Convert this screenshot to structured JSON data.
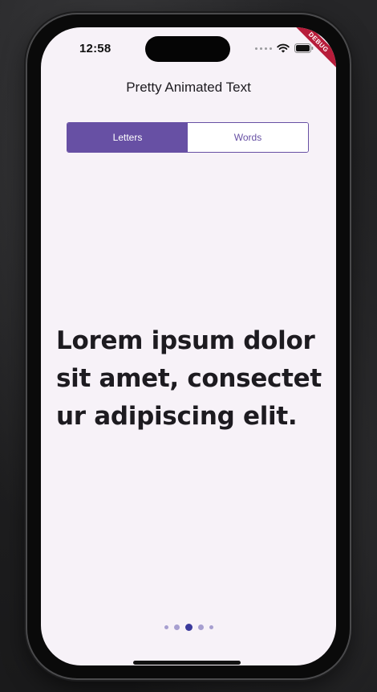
{
  "status_bar": {
    "time": "12:58"
  },
  "debug_banner": {
    "label": "DEBUG"
  },
  "app": {
    "title": "Pretty Animated Text"
  },
  "segmented_control": {
    "options": [
      {
        "label": "Letters",
        "selected": true
      },
      {
        "label": "Words",
        "selected": false
      }
    ]
  },
  "content": {
    "text": "Lorem ipsum dolor sit amet, consectet ur adipiscing elit."
  },
  "page_indicator": {
    "count": 5,
    "current_index": 2
  },
  "colors": {
    "accent": "#6750a4",
    "screen_background": "#f7f2f8",
    "text": "#1d1b20",
    "debug_ribbon": "#b71c3a",
    "indicator_active": "#3b3a9c",
    "indicator_inactive": "#a79fd0"
  },
  "icons": [
    "cellular-dots-icon",
    "wifi-icon",
    "battery-icon"
  ]
}
